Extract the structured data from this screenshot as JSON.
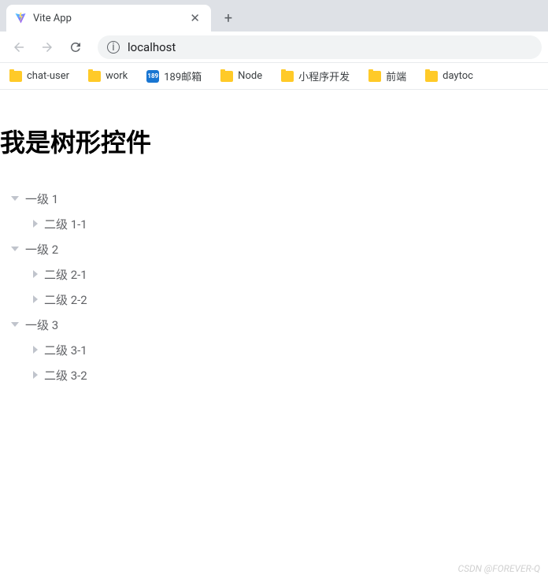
{
  "tab": {
    "title": "Vite App"
  },
  "address": {
    "url": "localhost"
  },
  "bookmarks": [
    {
      "label": "chat-user",
      "icon": "folder"
    },
    {
      "label": "work",
      "icon": "folder"
    },
    {
      "label": "189邮箱",
      "icon": "189"
    },
    {
      "label": "Node",
      "icon": "folder"
    },
    {
      "label": "小程序开发",
      "icon": "folder"
    },
    {
      "label": "前端",
      "icon": "folder"
    },
    {
      "label": "daytoc",
      "icon": "folder"
    }
  ],
  "page": {
    "title": "我是树形控件"
  },
  "tree": [
    {
      "label": "一级 1",
      "expanded": true,
      "children": [
        {
          "label": "二级 1-1",
          "expanded": false
        }
      ]
    },
    {
      "label": "一级 2",
      "expanded": true,
      "children": [
        {
          "label": "二级 2-1",
          "expanded": false
        },
        {
          "label": "二级 2-2",
          "expanded": false
        }
      ]
    },
    {
      "label": "一级 3",
      "expanded": true,
      "children": [
        {
          "label": "二级 3-1",
          "expanded": false
        },
        {
          "label": "二级 3-2",
          "expanded": false
        }
      ]
    }
  ],
  "watermark": "CSDN @FOREVER-Q"
}
